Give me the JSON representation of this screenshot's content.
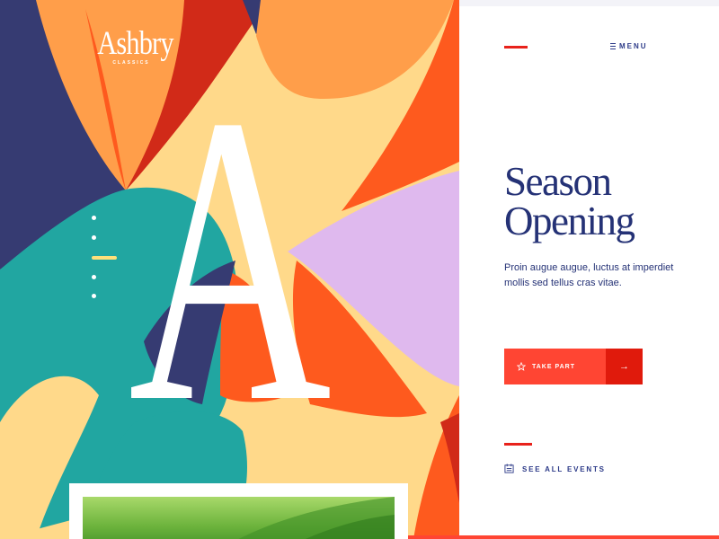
{
  "brand": {
    "name": "Ashbry",
    "tagline": "CLASSICS"
  },
  "hero": {
    "letter": "A"
  },
  "slider": {
    "count": 5,
    "active_index": 2
  },
  "nav": {
    "menu_label": "MENU"
  },
  "content": {
    "title_line1": "Season",
    "title_line2": "Opening",
    "description": "Proin augue augue, luctus at imperdiet mollis sed tellus cras vitae.",
    "cta_label": "TAKE PART",
    "cta_arrow": "→",
    "events_label": "SEE ALL EVENTS"
  },
  "colors": {
    "navy": "#253276",
    "accent_red": "#ff4533",
    "dark_red": "#e01a0c",
    "teal": "#21a6a1",
    "orange": "#fe5a1e",
    "light_orange": "#ff9e4a",
    "cream": "#ffd98a",
    "lavender": "#dfb9ee",
    "panel_bg": "#ffffff"
  },
  "icons": {
    "menu": "menu-icon",
    "cta": "star-icon",
    "cta_arrow": "arrow-right-icon",
    "events": "calendar-icon"
  }
}
